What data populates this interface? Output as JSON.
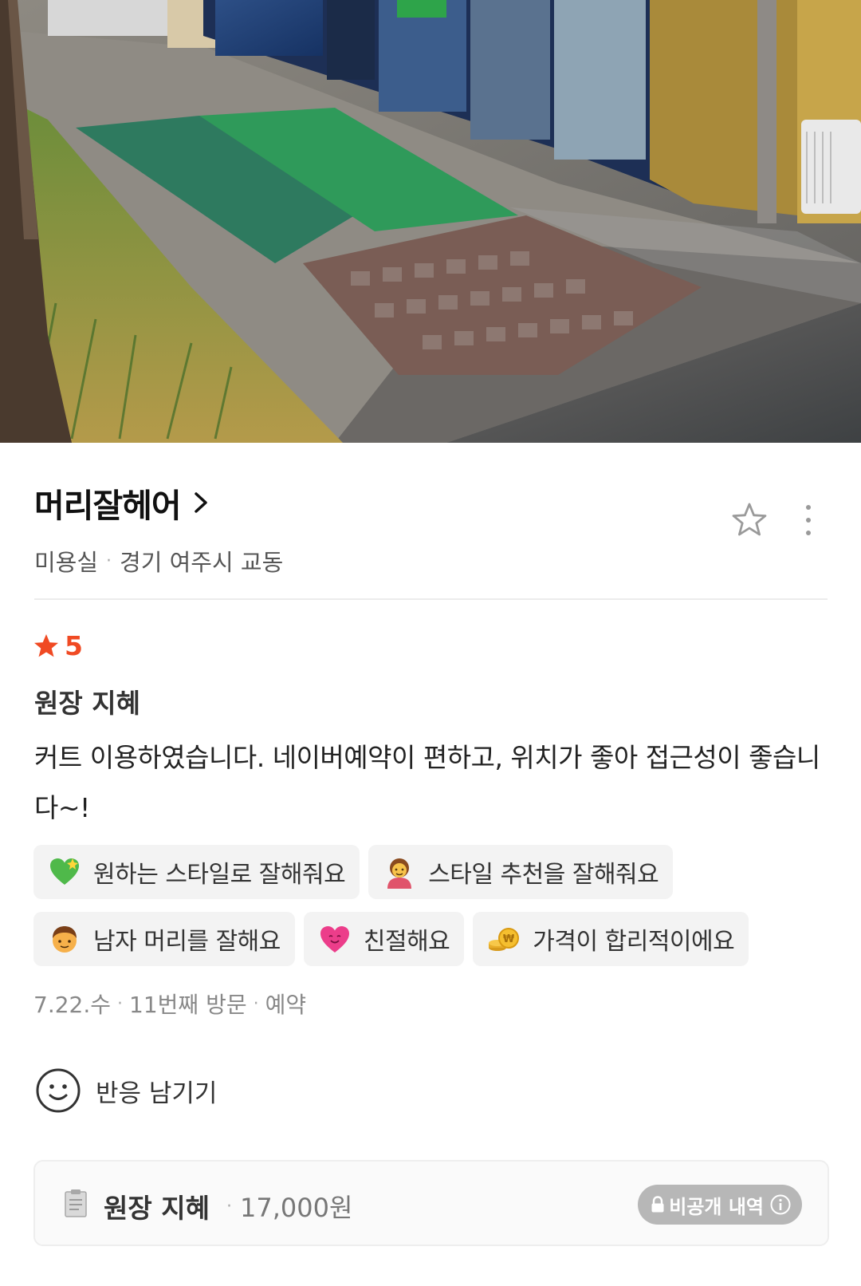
{
  "photo": {
    "alt_icon": "storefront-photo"
  },
  "place": {
    "name": "머리잘헤어",
    "category": "미용실",
    "location": "경기 여주시 교동"
  },
  "review": {
    "rating": "5",
    "reviewer": "원장 지혜",
    "text": "커트 이용하였습니다. 네이버예약이 편하고, 위치가 좋아 접근성이 좋습니다~!",
    "keywords": [
      {
        "label": "원하는 스타일로 잘해줘요",
        "icon": "green-heart-emoji"
      },
      {
        "label": "스타일 추천을 잘해줘요",
        "icon": "woman-getting-haircut-emoji"
      },
      {
        "label": "남자 머리를 잘해요",
        "icon": "boy-face-emoji"
      },
      {
        "label": "친절해요",
        "icon": "heart-face-emoji"
      },
      {
        "label": "가격이 합리적이에요",
        "icon": "coins-emoji"
      }
    ],
    "visit_date": "7.22.수",
    "visit_count": "11번째 방문",
    "visit_type": "예약",
    "react_label": "반응 남기기"
  },
  "receipt": {
    "staff": "원장 지혜",
    "price": "17,000원",
    "private_label": "비공개 내역"
  },
  "colors": {
    "rating_accent": "#f04a23",
    "chip_bg": "#f3f3f3",
    "badge_bg": "#b7b7b7"
  }
}
